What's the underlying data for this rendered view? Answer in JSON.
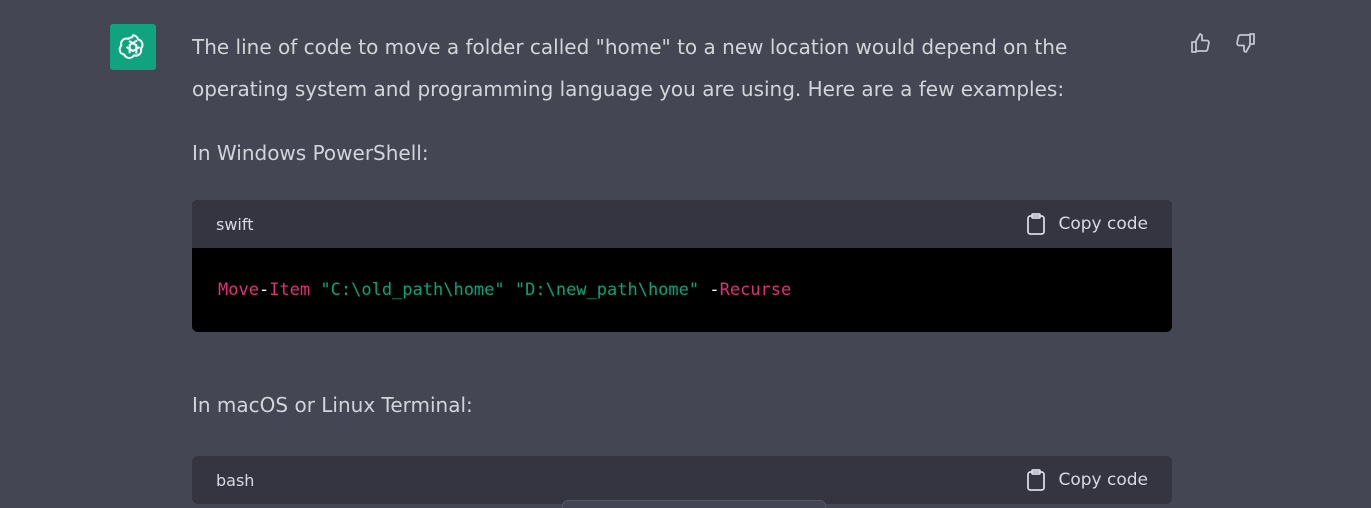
{
  "message": {
    "intro": "The line of code to move a folder called \"home\" to a new location would depend on the operating system and programming language you are using. Here are a few examples:",
    "section1_label": "In Windows PowerShell:",
    "section2_label": "In macOS or Linux Terminal:",
    "code_blocks": [
      {
        "language": "swift",
        "copy_label": "Copy code",
        "tokens": [
          {
            "type": "kw",
            "text": "Move"
          },
          {
            "type": "op",
            "text": "-"
          },
          {
            "type": "kw",
            "text": "Item"
          },
          {
            "type": "op",
            "text": " "
          },
          {
            "type": "str",
            "text": "\"C:\\old_path\\home\""
          },
          {
            "type": "op",
            "text": " "
          },
          {
            "type": "str",
            "text": "\"D:\\new_path\\home\""
          },
          {
            "type": "op",
            "text": " -"
          },
          {
            "type": "kw",
            "text": "Recurse"
          }
        ]
      },
      {
        "language": "bash",
        "copy_label": "Copy code"
      }
    ]
  },
  "icons": {
    "avatar": "openai-logo-icon",
    "thumbs_up": "thumbs-up-icon",
    "thumbs_down": "thumbs-down-icon",
    "copy": "clipboard-icon"
  },
  "colors": {
    "background": "#444654",
    "avatar_bg": "#10a37f",
    "code_header_bg": "#343541",
    "code_body_bg": "#000000",
    "keyword": "#df3079",
    "string": "#00a67d"
  }
}
